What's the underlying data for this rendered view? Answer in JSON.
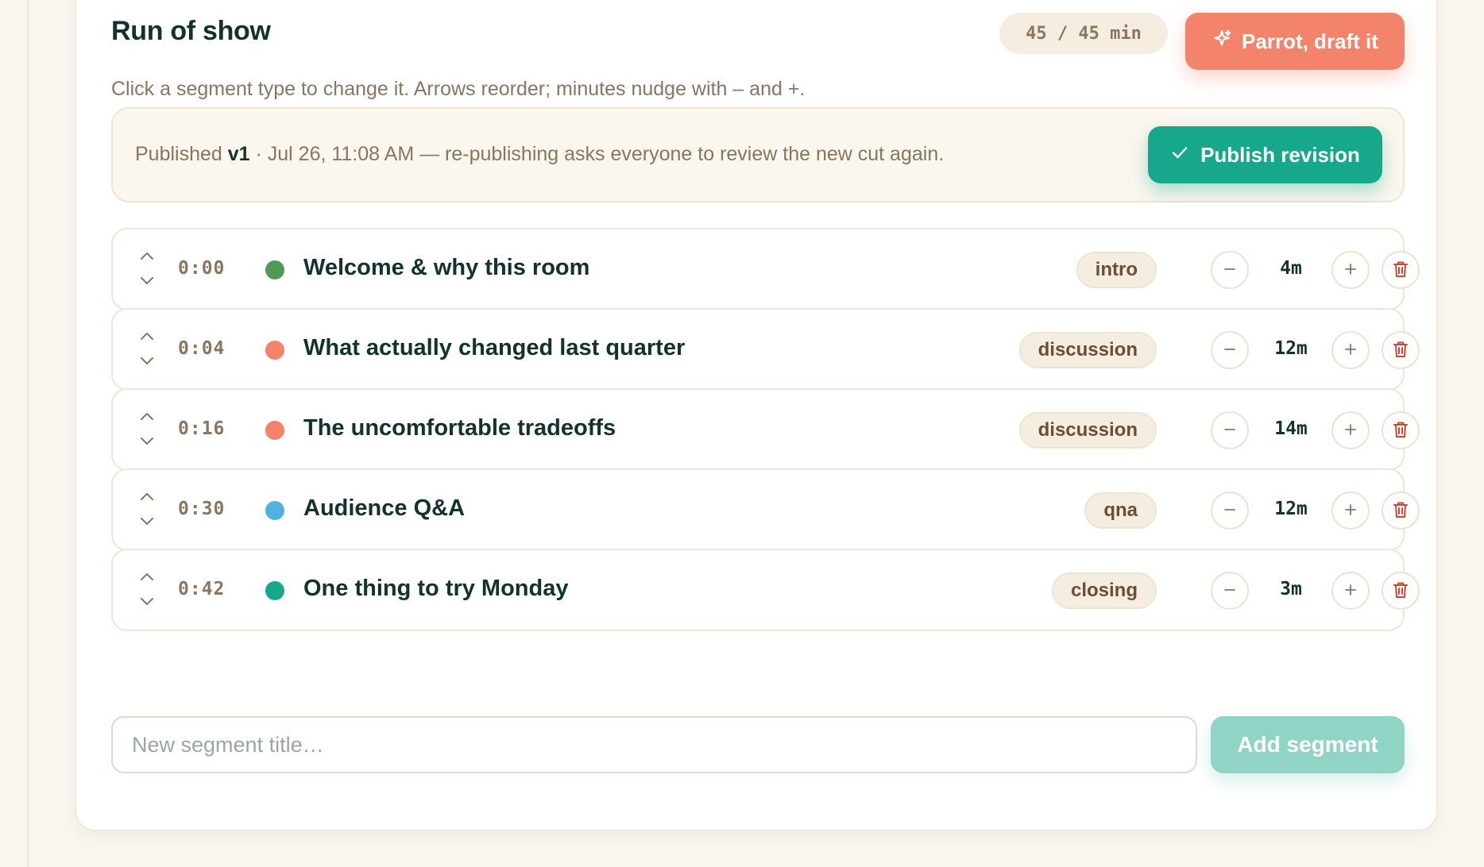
{
  "header": {
    "title": "Run of show",
    "total": "45 / 45 min",
    "draft_label": "Parrot, draft it",
    "subtitle": "Click a segment type to change it. Arrows reorder; minutes nudge with – and +."
  },
  "publish": {
    "prefix": "Published ",
    "version": "v1",
    "details": " · Jul 26, 11:08 AM — re-publishing asks everyone to review the new cut again.",
    "button_label": "Publish revision"
  },
  "segments": [
    {
      "time": "0:00",
      "title": "Welcome & why this room",
      "type": "intro",
      "minutes": "4m",
      "color": "#4f9a57"
    },
    {
      "time": "0:04",
      "title": "What actually changed last quarter",
      "type": "discussion",
      "minutes": "12m",
      "color": "#f3836a"
    },
    {
      "time": "0:16",
      "title": "The uncomfortable tradeoffs",
      "type": "discussion",
      "minutes": "14m",
      "color": "#f3836a"
    },
    {
      "time": "0:30",
      "title": "Audience Q&A",
      "type": "qna",
      "minutes": "12m",
      "color": "#4fb3de"
    },
    {
      "time": "0:42",
      "title": "One thing to try Monday",
      "type": "closing",
      "minutes": "3m",
      "color": "#17a88c"
    }
  ],
  "new_segment": {
    "placeholder": "New segment title…",
    "add_label": "Add segment"
  },
  "icons": {
    "draft": "sparkle-icon",
    "publish": "check-icon",
    "reorder_up": "chevron-up-icon",
    "reorder_down": "chevron-down-icon",
    "minus": "minus-icon",
    "plus": "plus-icon",
    "delete": "trash-icon"
  },
  "colors": {
    "accent_coral": "#f3836a",
    "accent_teal": "#17a88c",
    "delete_red": "#d4452f"
  }
}
